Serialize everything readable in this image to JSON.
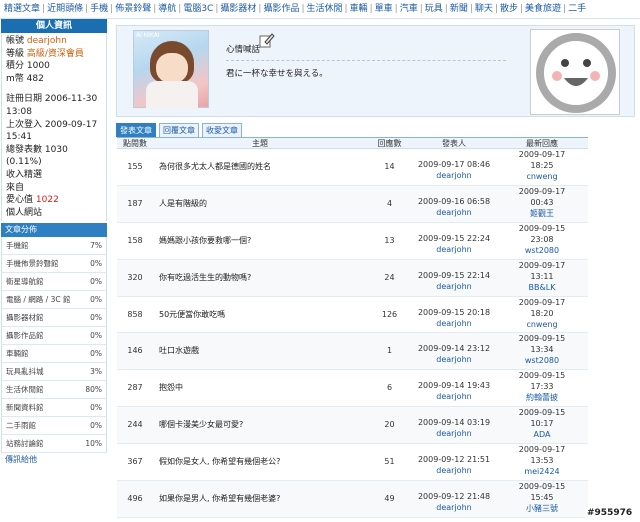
{
  "topnav": [
    "精選文章",
    "近期頭條",
    "手機",
    "佈景鈴聲",
    "導航",
    "電腦3C",
    "攝影器材",
    "攝影作品",
    "生活休閒",
    "車輛",
    "單車",
    "汽車",
    "玩具",
    "新聞",
    "聊天",
    "散步",
    "美食旅遊",
    "二手"
  ],
  "sidebar": {
    "title": "個人資訊",
    "account_label": "帳號",
    "account_value": "dearjohn",
    "level_label": "等級",
    "level_value": "高級/資深會員",
    "points_label": "積分",
    "points_value": "1000",
    "money_label": "m幣",
    "money_value": "482",
    "reg_label": "註冊日期",
    "reg_value": "2006-11-30",
    "reg_time": "13:08",
    "last_label": "上次登入",
    "last_value": "2009-09-17",
    "last_time": "15:41",
    "posts_label": "總發表數",
    "posts_value": "1030 (0.11%)",
    "fav_label": "收入精選",
    "from_label": "來自",
    "love_label": "愛心值",
    "love_value": "1022",
    "site_label": "個人網站",
    "art_title": "文章分佈",
    "art_items": [
      {
        "name": "手機館",
        "pct": "7%"
      },
      {
        "name": "手機佈景鈴聲館",
        "pct": "0%"
      },
      {
        "name": "衛星導航館",
        "pct": "0%"
      },
      {
        "name": "電腦 / 網路 / 3C 館",
        "pct": "0%"
      },
      {
        "name": "攝影器材館",
        "pct": "0%"
      },
      {
        "name": "攝影作品館",
        "pct": "0%"
      },
      {
        "name": "車輛館",
        "pct": "0%"
      },
      {
        "name": "玩具亂抖城",
        "pct": "3%"
      },
      {
        "name": "生活休閒館",
        "pct": "80%"
      },
      {
        "name": "新聞資料館",
        "pct": "0%"
      },
      {
        "name": "二手雨館",
        "pct": "0%"
      },
      {
        "name": "站務討論館",
        "pct": "10%"
      }
    ],
    "more": "傳訊給他"
  },
  "profile": {
    "avatar_tag": "Ai NIKAI",
    "mood_label": "心情喊話",
    "mood_text": "君に一杯な幸せを與える。"
  },
  "tabs": [
    "發表文章",
    "回覆文章",
    "收愛文章"
  ],
  "table": {
    "headers": [
      "點閱數",
      "主題",
      "回應數",
      "發表人",
      "最新回應"
    ],
    "rows": [
      {
        "views": "155",
        "topic": "為何很多尤太人都是德國的姓名",
        "replies": "14",
        "post_date": "2009-09-17 08:46",
        "poster": "dearjohn",
        "last_date": "2009-09-17",
        "last_time": "18:25",
        "last_user": "cnweng"
      },
      {
        "views": "187",
        "topic": "人是有階級的",
        "replies": "4",
        "post_date": "2009-09-16 06:58",
        "poster": "dearjohn",
        "last_date": "2009-09-17",
        "last_time": "00:43",
        "last_user": "姬觀王"
      },
      {
        "views": "158",
        "topic": "媽媽跟小孩你要救哪一個?",
        "replies": "13",
        "post_date": "2009-09-15 22:24",
        "poster": "dearjohn",
        "last_date": "2009-09-15",
        "last_time": "23:08",
        "last_user": "wst2080"
      },
      {
        "views": "320",
        "topic": "你有吃過活生生的動物嗎?",
        "replies": "24",
        "post_date": "2009-09-15 22:14",
        "poster": "dearjohn",
        "last_date": "2009-09-17",
        "last_time": "13:11",
        "last_user": "BB&LK"
      },
      {
        "views": "858",
        "topic": "50元便當你敢吃嗎",
        "replies": "126",
        "post_date": "2009-09-15 20:18",
        "poster": "dearjohn",
        "last_date": "2009-09-17",
        "last_time": "18:20",
        "last_user": "cnweng"
      },
      {
        "views": "146",
        "topic": "吐口水遊戲",
        "replies": "1",
        "post_date": "2009-09-14 23:12",
        "poster": "dearjohn",
        "last_date": "2009-09-15",
        "last_time": "13:34",
        "last_user": "wst2080"
      },
      {
        "views": "287",
        "topic": "抱怨中",
        "replies": "6",
        "post_date": "2009-09-14 19:43",
        "poster": "dearjohn",
        "last_date": "2009-09-15",
        "last_time": "17:33",
        "last_user": "約翰蕾披"
      },
      {
        "views": "244",
        "topic": "哪個卡漫美少女最可愛?",
        "replies": "20",
        "post_date": "2009-09-14 03:19",
        "poster": "dearjohn",
        "last_date": "2009-09-15",
        "last_time": "10:17",
        "last_user": "ADA"
      },
      {
        "views": "367",
        "topic": "假如你是女人, 你希望有幾個老公?",
        "replies": "51",
        "post_date": "2009-09-12 21:51",
        "poster": "dearjohn",
        "last_date": "2009-09-17",
        "last_time": "13:53",
        "last_user": "mei2424"
      },
      {
        "views": "496",
        "topic": "如果你是男人, 你希望有幾個老婆?",
        "replies": "49",
        "post_date": "2009-09-12 21:48",
        "poster": "dearjohn",
        "last_date": "2009-09-15",
        "last_time": "15:45",
        "last_user": "小豬三號"
      }
    ]
  },
  "watermark": "#955976",
  "colors": {
    "accent": "#1b6fb0",
    "link": "#1a5aa6",
    "orange": "#d06010",
    "red": "#d81c1c"
  }
}
